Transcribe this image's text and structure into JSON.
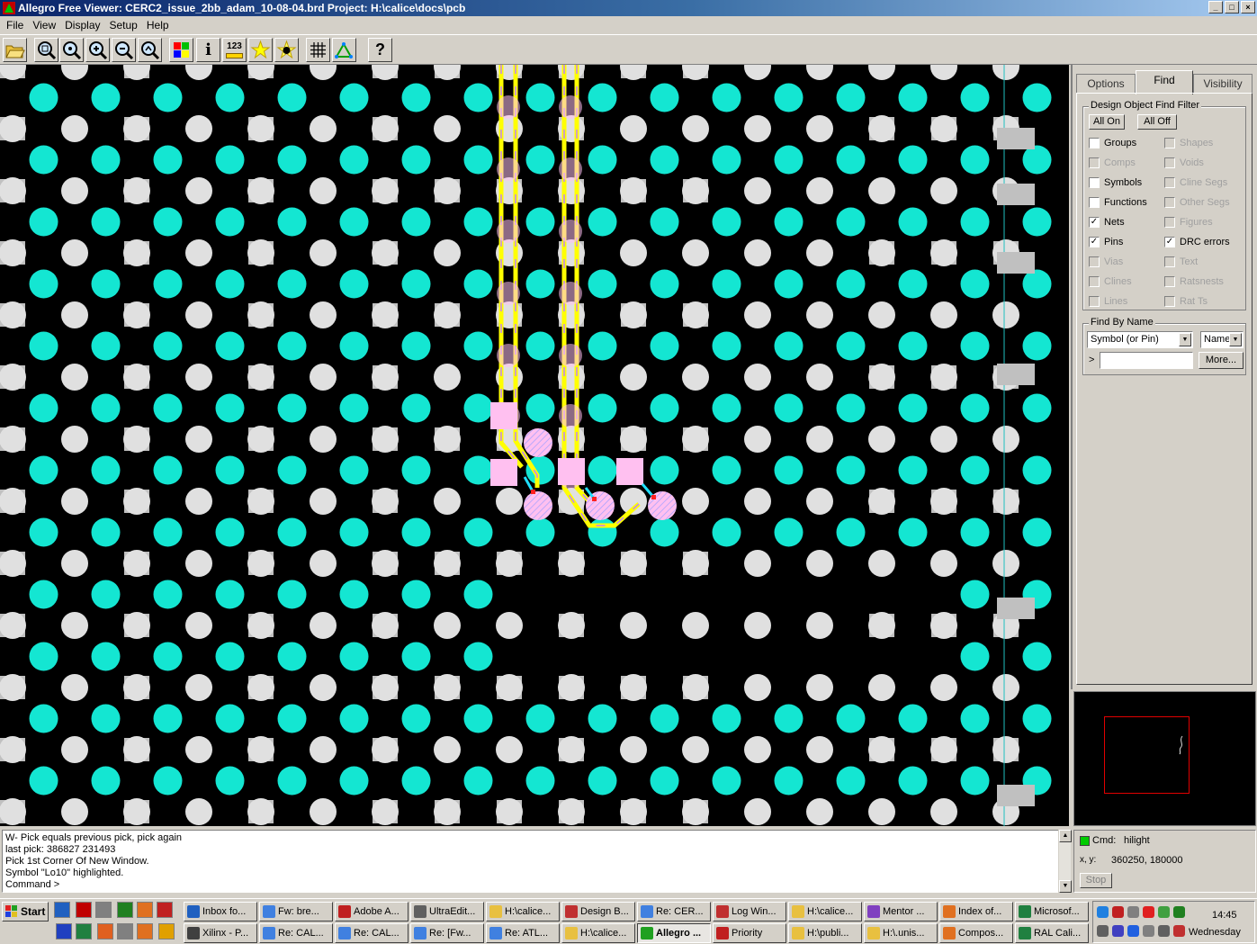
{
  "window": {
    "title": "Allegro Free Viewer: CERC2_issue_2bb_adam_10-08-04.brd  Project: H:\\calice\\docs\\pcb"
  },
  "menu": [
    "File",
    "View",
    "Display",
    "Setup",
    "Help"
  ],
  "toolbar": {
    "icons": [
      "open-folder-icon",
      "zoom-fit-icon",
      "zoom-window-icon",
      "zoom-in-icon",
      "zoom-out-icon",
      "zoom-previous-icon",
      "color-icon",
      "info-icon",
      "measure-icon",
      "highlight-icon",
      "dehighlight-icon",
      "grid-icon",
      "net-icon",
      "help-icon"
    ],
    "info_glyph": "i",
    "measure_text": "123",
    "help_glyph": "?"
  },
  "panel": {
    "tabs": [
      {
        "label": "Options",
        "active": false
      },
      {
        "label": "Find",
        "active": true
      },
      {
        "label": "Visibility",
        "active": false
      }
    ],
    "find_filter": {
      "title": "Design Object Find Filter",
      "all_on": "All On",
      "all_off": "All Off",
      "left": [
        {
          "label": "Groups",
          "checked": false,
          "enabled": true
        },
        {
          "label": "Comps",
          "checked": false,
          "enabled": false
        },
        {
          "label": "Symbols",
          "checked": false,
          "enabled": true
        },
        {
          "label": "Functions",
          "checked": false,
          "enabled": true
        },
        {
          "label": "Nets",
          "checked": true,
          "enabled": true
        },
        {
          "label": "Pins",
          "checked": true,
          "enabled": true
        },
        {
          "label": "Vias",
          "checked": false,
          "enabled": false
        },
        {
          "label": "Clines",
          "checked": false,
          "enabled": false
        },
        {
          "label": "Lines",
          "checked": false,
          "enabled": false
        }
      ],
      "right": [
        {
          "label": "Shapes",
          "checked": false,
          "enabled": false
        },
        {
          "label": "Voids",
          "checked": false,
          "enabled": false
        },
        {
          "label": "Cline Segs",
          "checked": false,
          "enabled": false
        },
        {
          "label": "Other Segs",
          "checked": false,
          "enabled": false
        },
        {
          "label": "Figures",
          "checked": false,
          "enabled": false
        },
        {
          "label": "DRC errors",
          "checked": true,
          "enabled": true
        },
        {
          "label": "Text",
          "checked": false,
          "enabled": false
        },
        {
          "label": "Ratsnests",
          "checked": false,
          "enabled": false
        },
        {
          "label": "Rat Ts",
          "checked": false,
          "enabled": false
        }
      ]
    },
    "find_by_name": {
      "title": "Find By Name",
      "type_value": "Symbol (or Pin)",
      "mode_value": "Name",
      "prompt": ">",
      "input_value": "",
      "more": "More..."
    }
  },
  "console": {
    "lines": [
      "W- Pick equals previous pick, pick again",
      "last pick:  386827  231493",
      "Pick 1st Corner Of New Window.",
      "Symbol \"Lo10\" highlighted.",
      "Command >"
    ]
  },
  "status": {
    "cmd_label": "Cmd:",
    "cmd_value": "hilight",
    "xy_label": "x, y:",
    "xy_value": "360250, 180000",
    "stop": "Stop",
    "indicator_color": "#00cc00"
  },
  "taskbar": {
    "start": "Start",
    "row1": [
      {
        "label": "Inbox fo...",
        "icon": "outlook-icon"
      },
      {
        "label": "Fw: bre...",
        "icon": "mail-icon"
      },
      {
        "label": "Adobe A...",
        "icon": "acrobat-icon"
      },
      {
        "label": "UltraEdit...",
        "icon": "ultraedit-icon"
      },
      {
        "label": "H:\\calice...",
        "icon": "folder-icon"
      },
      {
        "label": "Design B...",
        "icon": "design-icon"
      },
      {
        "label": "Re: CER...",
        "icon": "mail-icon"
      },
      {
        "label": "Log Win...",
        "icon": "log-icon"
      },
      {
        "label": "H:\\calice...",
        "icon": "folder-icon"
      },
      {
        "label": "Mentor ...",
        "icon": "mentor-icon"
      },
      {
        "label": "Index of...",
        "icon": "browser-icon"
      },
      {
        "label": "Microsof...",
        "icon": "excel-icon"
      }
    ],
    "row2": [
      {
        "label": "Xilinx - P...",
        "icon": "xilinx-icon",
        "active": false
      },
      {
        "label": "Re: CAL...",
        "icon": "mail-icon",
        "active": false
      },
      {
        "label": "Re: CAL...",
        "icon": "mail-icon",
        "active": false
      },
      {
        "label": "Re: [Fw...",
        "icon": "mail-icon",
        "active": false
      },
      {
        "label": "Re: ATL...",
        "icon": "mail-icon",
        "active": false
      },
      {
        "label": "H:\\calice...",
        "icon": "folder-icon",
        "active": false
      },
      {
        "label": "Allegro ...",
        "icon": "allegro-icon",
        "active": true
      },
      {
        "label": "Priority",
        "icon": "priority-icon",
        "active": false
      },
      {
        "label": "H:\\publi...",
        "icon": "folder-icon",
        "active": false
      },
      {
        "label": "H:\\.unis...",
        "icon": "folder-icon",
        "active": false
      },
      {
        "label": "Compos...",
        "icon": "browser-icon",
        "active": false
      },
      {
        "label": "RAL Cali...",
        "icon": "excel-icon",
        "active": false
      }
    ],
    "clock": "14:45",
    "day": "Wednesday"
  },
  "colors": {
    "cyan_pad": "#14e6d2",
    "grey_pad": "#e0e0e0",
    "grey_square": "#c0c0c0",
    "trace": "#ffff00",
    "highlight": "#ffc0f0"
  }
}
